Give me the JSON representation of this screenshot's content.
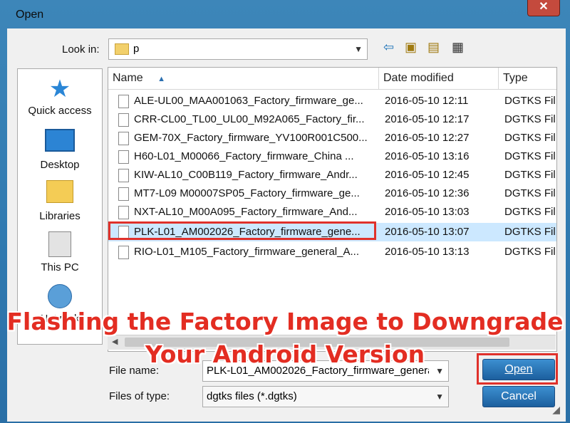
{
  "window": {
    "title": "Open",
    "close_glyph": "✕"
  },
  "lookin": {
    "label": "Look in:",
    "value": "p"
  },
  "toolbar": {
    "back_icon": "back-arrow-icon",
    "up_icon": "up-folder-icon",
    "new_icon": "new-folder-icon",
    "view_icon": "view-menu-icon"
  },
  "places": [
    {
      "label": "Quick access"
    },
    {
      "label": "Desktop"
    },
    {
      "label": "Libraries"
    },
    {
      "label": "This PC"
    },
    {
      "label": "Network"
    }
  ],
  "columns": {
    "name": "Name",
    "sort_glyph": "▲",
    "date": "Date modified",
    "type": "Type"
  },
  "files": [
    {
      "name": "ALE-UL00_MAA001063_Factory_firmware_ge...",
      "date": "2016-05-10 12:11",
      "type": "DGTKS Fil"
    },
    {
      "name": "CRR-CL00_TL00_UL00_M92A065_Factory_fir...",
      "date": "2016-05-10 12:17",
      "type": "DGTKS Fil"
    },
    {
      "name": "GEM-70X_Factory_firmware_YV100R001C500...",
      "date": "2016-05-10 12:27",
      "type": "DGTKS Fil"
    },
    {
      "name": "H60-L01_M00066_Factory_firmware_China ...",
      "date": "2016-05-10 13:16",
      "type": "DGTKS Fil"
    },
    {
      "name": "KIW-AL10_C00B119_Factory_firmware_Andr...",
      "date": "2016-05-10 12:45",
      "type": "DGTKS Fil"
    },
    {
      "name": "MT7-L09 M00007SP05_Factory_firmware_ge...",
      "date": "2016-05-10 12:36",
      "type": "DGTKS Fil"
    },
    {
      "name": "NXT-AL10_M00A095_Factory_firmware_And...",
      "date": "2016-05-10 13:03",
      "type": "DGTKS Fil"
    },
    {
      "name": "PLK-L01_AM002026_Factory_firmware_gene...",
      "date": "2016-05-10 13:07",
      "type": "DGTKS Fil"
    },
    {
      "name": "RIO-L01_M105_Factory_firmware_general_A...",
      "date": "2016-05-10 13:13",
      "type": "DGTKS Fil"
    }
  ],
  "filename": {
    "label": "File name:",
    "value": "PLK-L01_AM002026_Factory_firmware_genera"
  },
  "filetype": {
    "label": "Files of type:",
    "value": "dgtks files (*.dgtks)"
  },
  "buttons": {
    "open": "Open",
    "cancel": "Cancel"
  },
  "caption": {
    "line1": "Flashing the Factory Image to Downgrade",
    "line2": "Your Android Version"
  },
  "colors": {
    "highlight": "#e0312b",
    "selection": "#cce8ff",
    "caption": "#e32d22"
  }
}
